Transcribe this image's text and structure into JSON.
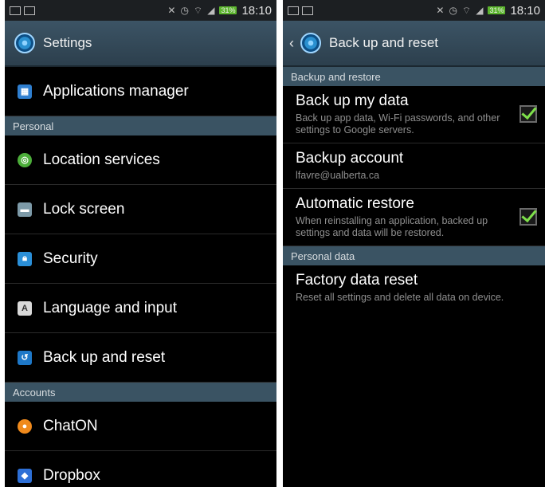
{
  "status_bar": {
    "battery": "31%",
    "time": "18:10"
  },
  "left_screen": {
    "title": "Settings",
    "items_top": [
      {
        "label": "Applications manager",
        "icon": "grid-icon",
        "color": "#2f7fd0"
      }
    ],
    "sections": [
      {
        "header": "Personal",
        "items": [
          {
            "label": "Location services",
            "icon": "location-icon",
            "color": "#4cae3a"
          },
          {
            "label": "Lock screen",
            "icon": "lock-screen-icon",
            "color": "#7d9aa8"
          },
          {
            "label": "Security",
            "icon": "padlock-icon",
            "color": "#2a8fd8"
          },
          {
            "label": "Language and input",
            "icon": "keyboard-a-icon",
            "color": "#d9d9d9"
          },
          {
            "label": "Back up and reset",
            "icon": "backup-icon",
            "color": "#1e78c8"
          }
        ]
      },
      {
        "header": "Accounts",
        "items": [
          {
            "label": "ChatON",
            "icon": "chaton-icon",
            "color": "#f08a1c"
          },
          {
            "label": "Dropbox",
            "icon": "dropbox-icon",
            "color": "#2d6fd6"
          }
        ]
      }
    ]
  },
  "right_screen": {
    "title": "Back up and reset",
    "sections": [
      {
        "header": "Backup and restore",
        "items": [
          {
            "title": "Back up my data",
            "subtitle": "Back up app data, Wi-Fi passwords, and other settings to Google servers.",
            "checked": true
          },
          {
            "title": "Backup account",
            "subtitle": "lfavre@ualberta.ca",
            "checked": false
          },
          {
            "title": "Automatic restore",
            "subtitle": "When reinstalling an application, backed up settings and data will be restored.",
            "checked": true
          }
        ]
      },
      {
        "header": "Personal data",
        "items": [
          {
            "title": "Factory data reset",
            "subtitle": "Reset all settings and delete all data on device.",
            "checked": false
          }
        ]
      }
    ]
  }
}
